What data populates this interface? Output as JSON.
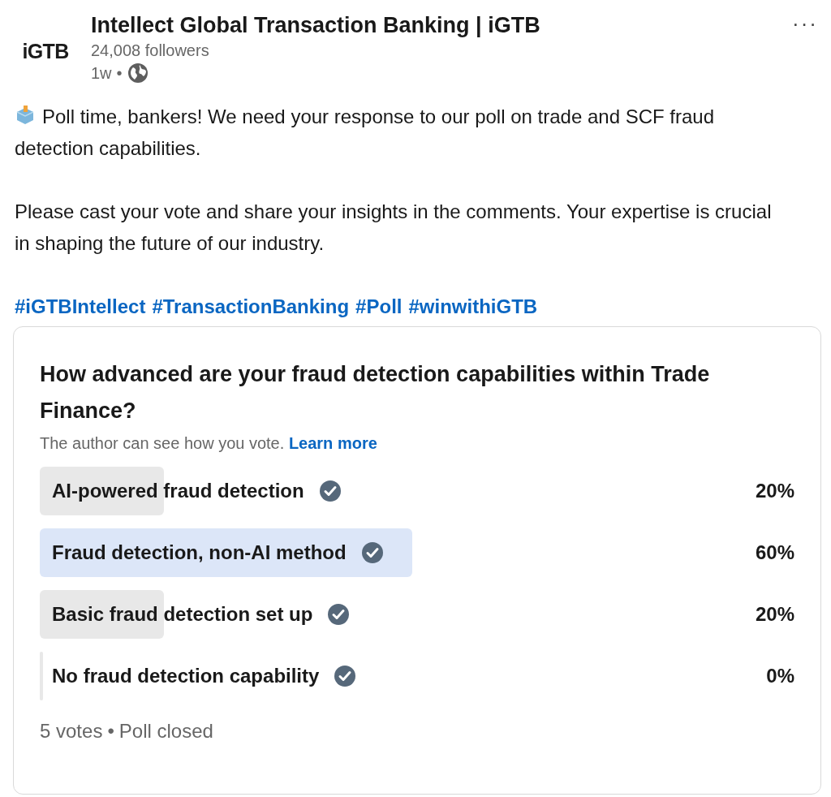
{
  "author": {
    "name": "Intellect Global Transaction Banking | iGTB",
    "followers": "24,008 followers",
    "time": "1w",
    "separator": "•",
    "logo_text": "iGTB"
  },
  "menu_button": "···",
  "post": {
    "paragraphs": [
      "Poll time, bankers! We need your response to our poll on trade and SCF fraud detection capabilities.",
      "Please cast your vote and share your insights in the comments. Your expertise is crucial in shaping the future of our industry."
    ],
    "hashtags": [
      "#iGTBIntellect",
      "#TransactionBanking",
      "#Poll",
      "#winwithiGTB"
    ]
  },
  "poll": {
    "question": "How advanced are your fraud detection capabilities within Trade Finance?",
    "note": "The author can see how you vote.",
    "link": "Learn more",
    "options": [
      {
        "label": "AI-powered fraud detection",
        "percent": "20%",
        "selected": false
      },
      {
        "label": "Fraud detection, non-AI method",
        "percent": "60%",
        "selected": true
      },
      {
        "label": "Basic fraud detection set up",
        "percent": "20%",
        "selected": false
      },
      {
        "label": "No fraud detection capability",
        "percent": "0%",
        "selected": false
      }
    ],
    "votes": "5 votes",
    "separator": "•",
    "status": "Poll closed"
  }
}
